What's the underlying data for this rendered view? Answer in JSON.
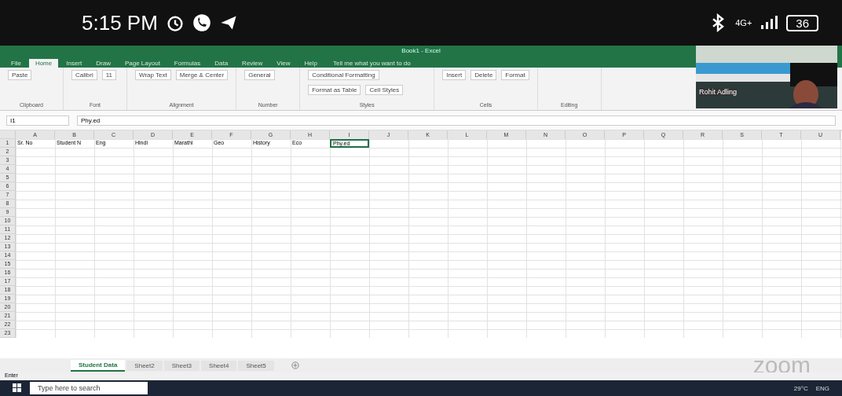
{
  "status_bar": {
    "time": "5:15 PM",
    "network": "4G+",
    "battery": "36"
  },
  "excel": {
    "title": "Book1 - Excel",
    "tabs": [
      {
        "label": "File",
        "selected": false
      },
      {
        "label": "Home",
        "selected": true
      },
      {
        "label": "Insert",
        "selected": false
      },
      {
        "label": "Draw",
        "selected": false
      },
      {
        "label": "Page Layout",
        "selected": false
      },
      {
        "label": "Formulas",
        "selected": false
      },
      {
        "label": "Data",
        "selected": false
      },
      {
        "label": "Review",
        "selected": false
      },
      {
        "label": "View",
        "selected": false
      },
      {
        "label": "Help",
        "selected": false
      }
    ],
    "tell_me": {
      "placeholder": "Tell me what you want to do"
    },
    "ribbon_groups": [
      {
        "label": "Clipboard",
        "buttons": [
          "Paste"
        ]
      },
      {
        "label": "Font",
        "buttons": [
          "Calibri",
          "11"
        ]
      },
      {
        "label": "Alignment",
        "buttons": [
          "Wrap Text",
          "Merge & Center"
        ]
      },
      {
        "label": "Number",
        "buttons": [
          "General"
        ]
      },
      {
        "label": "Styles",
        "buttons": [
          "Conditional Formatting",
          "Format as Table",
          "Cell Styles"
        ]
      },
      {
        "label": "Cells",
        "buttons": [
          "Insert",
          "Delete",
          "Format"
        ]
      },
      {
        "label": "Editing"
      }
    ],
    "name_box": "I1",
    "formula": "Phy.ed",
    "columns": [
      "A",
      "B",
      "C",
      "D",
      "E",
      "F",
      "G",
      "H",
      "I",
      "J",
      "K",
      "L",
      "M",
      "N",
      "O",
      "P",
      "Q",
      "R",
      "S",
      "T",
      "U"
    ],
    "rows": [
      {
        "number": "1",
        "cells": [
          {
            "text": "Sr. No",
            "selected": false
          },
          {
            "text": "Student N",
            "selected": false
          },
          {
            "text": "Eng",
            "selected": false
          },
          {
            "text": "Hindi",
            "selected": false
          },
          {
            "text": "Marathi",
            "selected": false
          },
          {
            "text": "Geo",
            "selected": false
          },
          {
            "text": "History",
            "selected": false
          },
          {
            "text": "Eco",
            "selected": false
          },
          {
            "text": "Phy.ed",
            "selected": true
          }
        ]
      },
      {
        "number": "2",
        "cells": []
      },
      {
        "number": "3",
        "cells": []
      },
      {
        "number": "4",
        "cells": []
      },
      {
        "number": "5",
        "cells": []
      },
      {
        "number": "6",
        "cells": []
      },
      {
        "number": "7",
        "cells": []
      },
      {
        "number": "8",
        "cells": []
      },
      {
        "number": "9",
        "cells": []
      },
      {
        "number": "10",
        "cells": []
      },
      {
        "number": "11",
        "cells": []
      },
      {
        "number": "12",
        "cells": []
      },
      {
        "number": "13",
        "cells": []
      },
      {
        "number": "14",
        "cells": []
      },
      {
        "number": "15",
        "cells": []
      },
      {
        "number": "16",
        "cells": []
      },
      {
        "number": "17",
        "cells": []
      },
      {
        "number": "18",
        "cells": []
      },
      {
        "number": "19",
        "cells": []
      },
      {
        "number": "20",
        "cells": []
      },
      {
        "number": "21",
        "cells": []
      },
      {
        "number": "22",
        "cells": []
      },
      {
        "number": "23",
        "cells": []
      }
    ],
    "sheets": [
      {
        "label": "Student Data",
        "selected": true
      },
      {
        "label": "Sheet2",
        "selected": false
      },
      {
        "label": "Sheet3",
        "selected": false
      },
      {
        "label": "Sheet4",
        "selected": false
      },
      {
        "label": "Sheet5",
        "selected": false
      }
    ],
    "mode": "Enter"
  },
  "video": {
    "name": "Rohit Adling"
  },
  "zoom_logo": "zoom",
  "taskbar": {
    "search": {
      "placeholder": "Type here to search"
    },
    "weather": "29°C",
    "language": "ENG"
  }
}
